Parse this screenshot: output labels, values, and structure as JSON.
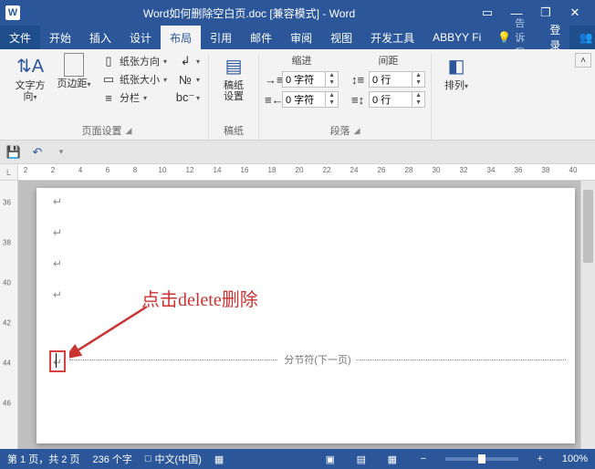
{
  "title": "Word如何删除空白页.doc [兼容模式] - Word",
  "tabs": {
    "file": "文件",
    "home": "开始",
    "insert": "插入",
    "design": "设计",
    "layout": "布局",
    "references": "引用",
    "mailings": "邮件",
    "review": "审阅",
    "view": "视图",
    "dev": "开发工具",
    "abbyy": "ABBYY Fi"
  },
  "tell_me": "告诉我...",
  "login": "登录",
  "share": "共享",
  "ribbon": {
    "text_dir": "文字方向",
    "margins": "页边距",
    "orientation": "纸张方向",
    "size": "纸张大小",
    "columns": "分栏",
    "manuscript": "稿纸\n设置",
    "indent_hdr": "缩进",
    "spacing_hdr": "间距",
    "indent_left": "0 字符",
    "indent_right": "0 字符",
    "spacing_before": "0 行",
    "spacing_after": "0 行",
    "arrange": "排列",
    "grp_page": "页面设置",
    "grp_manu": "稿纸",
    "grp_para": "段落"
  },
  "ruler_h": [
    "2",
    "2",
    "4",
    "6",
    "8",
    "10",
    "12",
    "14",
    "16",
    "18",
    "20",
    "22",
    "24",
    "26",
    "28",
    "30",
    "32",
    "34",
    "36",
    "38",
    "40"
  ],
  "ruler_v": [
    "36",
    "38",
    "40",
    "42",
    "44",
    "46"
  ],
  "doc": {
    "section_break": "分节符(下一页)",
    "annotation": "点击delete删除"
  },
  "status": {
    "page": "第 1 页，共 2 页",
    "words": "236 个字",
    "lang": "中文(中国)",
    "zoom": "100%"
  }
}
